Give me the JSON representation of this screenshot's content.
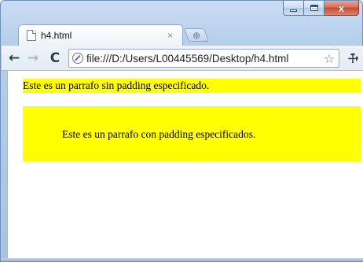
{
  "window": {
    "caption": {
      "minimize_icon": "minimize-icon",
      "maximize_icon": "maximize-icon",
      "close_icon": "close-icon",
      "close_color": "#c74a32"
    }
  },
  "tabs": [
    {
      "title": "h4.html",
      "active": true,
      "close_glyph": "×"
    }
  ],
  "new_tab_glyph": "⊕",
  "toolbar": {
    "back_glyph": "←",
    "forward_glyph": "→",
    "reload_glyph": "C",
    "url": "file:///D:/Users/L00445569/Desktop/h4.html",
    "star_glyph": "☆",
    "wrench_glyph": "🔧"
  },
  "page": {
    "background": "#ffffff",
    "highlight_color": "#ffff00",
    "paragraphs": [
      {
        "text": "Este es un parrafo sin padding especificado."
      },
      {
        "text": "Este es un parrafo con padding especificados."
      }
    ]
  }
}
